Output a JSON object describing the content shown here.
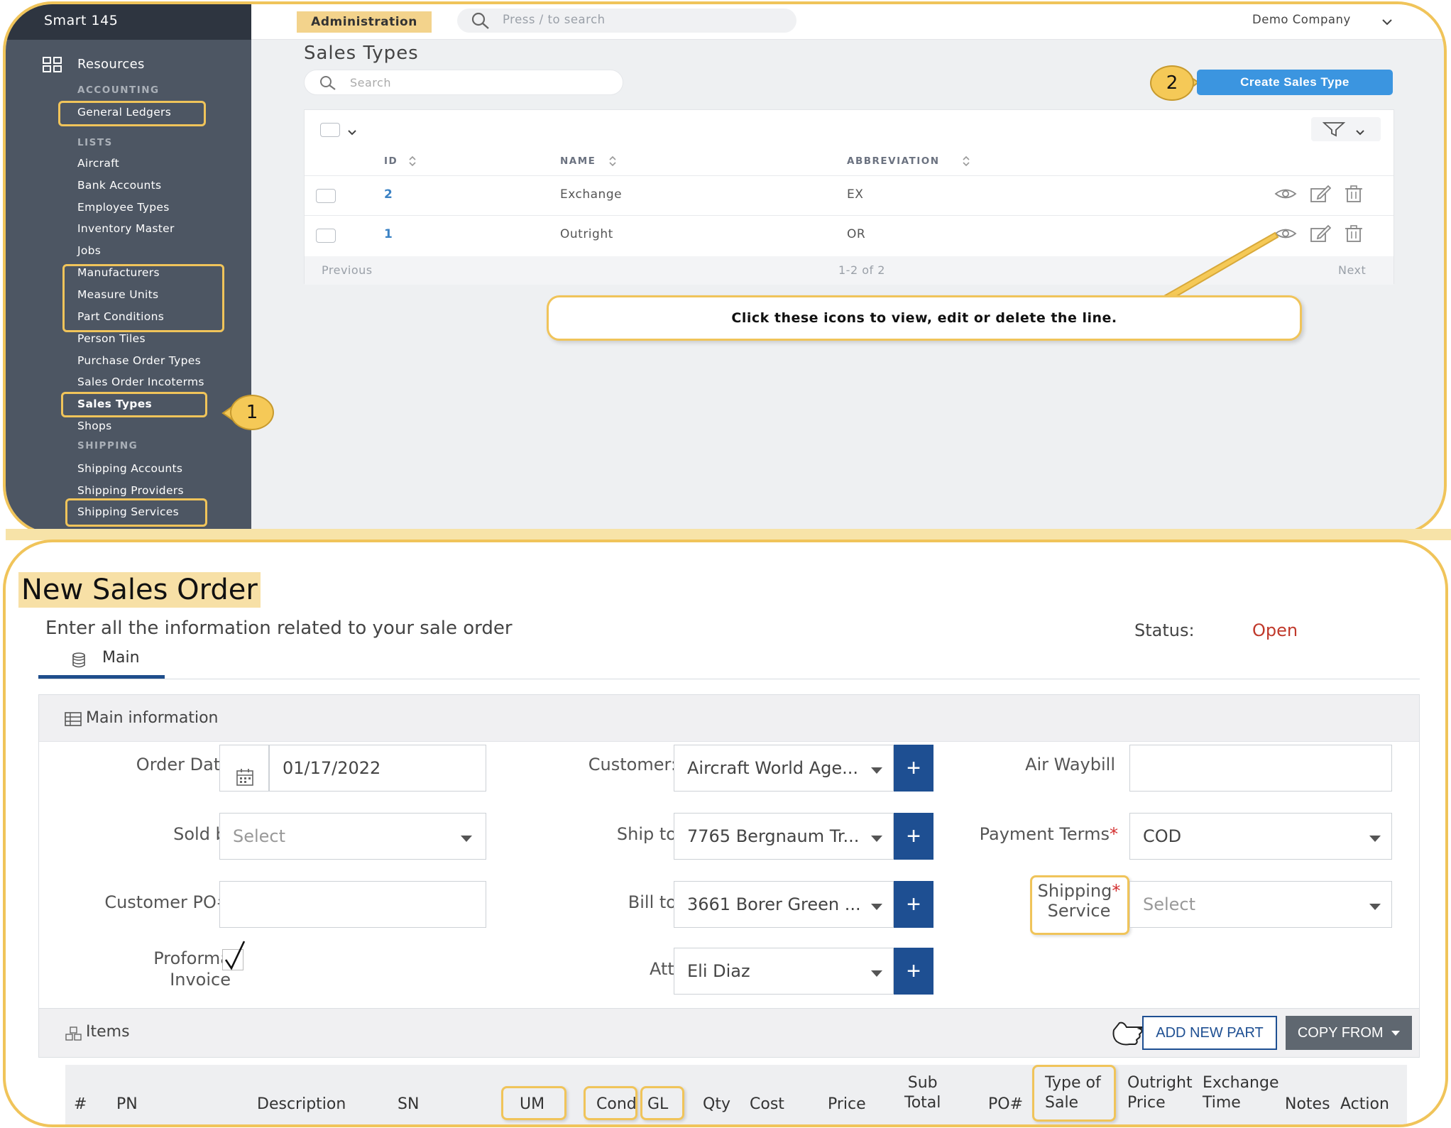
{
  "admin": {
    "brand": "Smart 145",
    "section_tab": "Administration",
    "search_placeholder": "Press / to search",
    "company": "Demo Company",
    "sidebar": {
      "resources": "Resources",
      "headers": {
        "accounting": "ACCOUNTING",
        "lists": "LISTS",
        "shipping": "SHIPPING"
      },
      "items": {
        "general_ledgers": "General Ledgers",
        "aircraft": "Aircraft",
        "bank_accounts": "Bank Accounts",
        "employee_types": "Employee Types",
        "inventory_master": "Inventory Master",
        "jobs": "Jobs",
        "manufacturers": "Manufacturers",
        "measure_units": "Measure Units",
        "part_conditions": "Part Conditions",
        "person_tiles": "Person Tiles",
        "purchase_order_types": "Purchase Order Types",
        "sales_order_incoterms": "Sales Order Incoterms",
        "sales_types": "Sales Types",
        "shops": "Shops",
        "shipping_accounts": "Shipping Accounts",
        "shipping_providers": "Shipping Providers",
        "shipping_services": "Shipping Services"
      }
    },
    "page_title": "Sales Types",
    "page_search_placeholder": "Search",
    "create_button": "Create Sales Type",
    "table": {
      "headers": {
        "id": "ID",
        "name": "NAME",
        "abbreviation": "ABBREVIATION"
      },
      "rows": [
        {
          "id": "2",
          "name": "Exchange",
          "abbreviation": "EX"
        },
        {
          "id": "1",
          "name": "Outright",
          "abbreviation": "OR"
        }
      ],
      "previous": "Previous",
      "range": "1-2 of 2",
      "next": "Next"
    },
    "callouts": {
      "one": "1",
      "two": "2"
    },
    "tip": "Click these icons to view, edit or delete the line."
  },
  "sales_order": {
    "title": "New Sales Order",
    "subtitle": "Enter all the information related to your sale order",
    "status_label": "Status:",
    "status_value": "Open",
    "tab_main": "Main",
    "main_info": "Main information",
    "fields": {
      "order_date_label": "Order Date",
      "order_date_value": "01/17/2022",
      "customer_label": "Customer:",
      "customer_value": "Aircraft World Age...",
      "air_waybill_label": "Air Waybill",
      "sold_by_label": "Sold by",
      "sold_by_value": "Select",
      "ship_to_label": "Ship to",
      "ship_to_value": "7765 Bergnaum Tr...",
      "payment_terms_label": "Payment Terms",
      "payment_terms_value": "COD",
      "customer_po_label": "Customer PO#",
      "bill_to_label": "Bill to",
      "bill_to_value": "3661 Borer Green ...",
      "shipping_service_label_1": "Shipping",
      "shipping_service_label_2": "Service",
      "shipping_service_value": "Select",
      "proforma_label_1": "Proforma",
      "proforma_label_2": "Invoice",
      "attn_label": "Attn",
      "attn_value": "Eli Diaz",
      "required_mark": "*",
      "plus": "+"
    },
    "items": {
      "title": "Items",
      "add_new_part": "ADD NEW PART",
      "copy_from": "COPY FROM",
      "columns": {
        "num": "#",
        "pn": "PN",
        "description": "Description",
        "sn": "SN",
        "um": "UM",
        "cond": "Cond",
        "gl": "GL",
        "qty": "Qty",
        "cost": "Cost",
        "price": "Price",
        "sub_total_1": "Sub",
        "sub_total_2": "Total",
        "po": "PO#",
        "type_of_sale_1": "Type of",
        "type_of_sale_2": "Sale",
        "outright_price_1": "Outright",
        "outright_price_2": "Price",
        "exchange_time_1": "Exchange",
        "exchange_time_2": "Time",
        "notes": "Notes",
        "action": "Action"
      }
    }
  },
  "colors": {
    "accent": "#f0c45a",
    "primary": "#3b95e0",
    "navy": "#1e4f92",
    "status": "#c0392b"
  }
}
